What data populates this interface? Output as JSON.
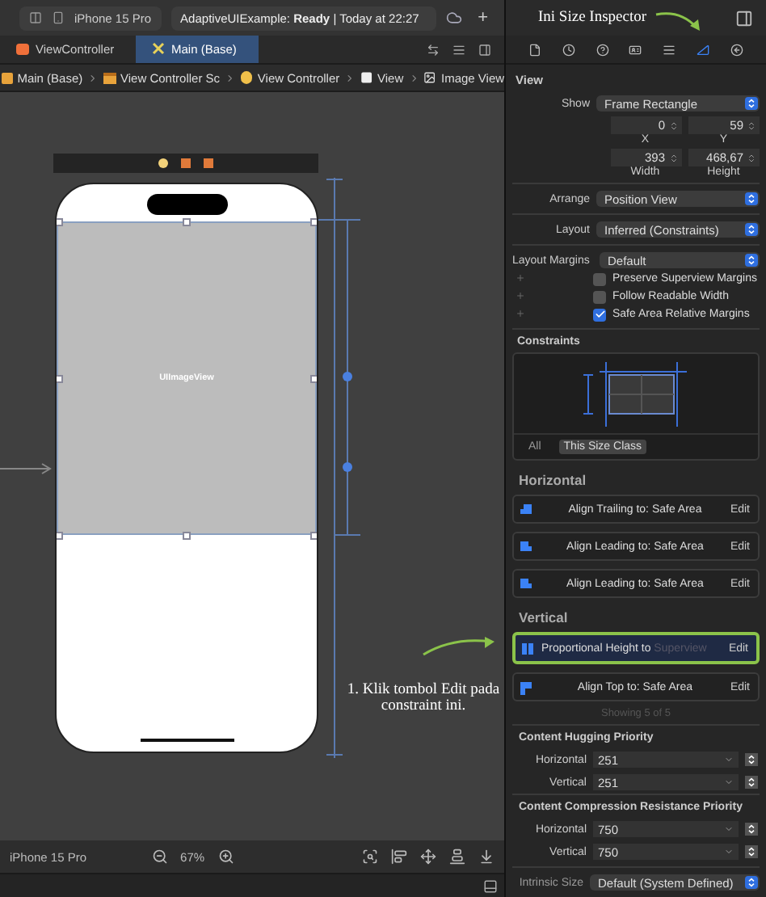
{
  "toolbar": {
    "device": "iPhone 15 Pro",
    "status": "AdaptiveUIExample: **Ready** | Today at 22:27",
    "add_button": "+"
  },
  "annotations": [
    {
      "text": "Ini Size Inspector"
    },
    {
      "text": "1. Klik tombol Edit pada constraint ini."
    }
  ],
  "editor_tabs": [
    {
      "label": "ViewController",
      "selected": false,
      "kind": "swift"
    },
    {
      "label": "Main (Base)",
      "selected": true,
      "kind": "storyboard"
    }
  ],
  "breadcrumb": [
    {
      "label": "Main (Base)",
      "kind": "storyboard"
    },
    {
      "label": "View Controller Sc",
      "kind": "scene"
    },
    {
      "label": "View Controller",
      "kind": "controller"
    },
    {
      "label": "View",
      "kind": "view"
    },
    {
      "label": "Image View",
      "kind": "image"
    }
  ],
  "inspector_tabs": [
    {
      "kind": "file",
      "selected": false
    },
    {
      "kind": "history",
      "selected": false
    },
    {
      "kind": "help",
      "selected": false
    },
    {
      "kind": "identity",
      "selected": false
    },
    {
      "kind": "attributes",
      "selected": false
    },
    {
      "kind": "size",
      "selected": true
    },
    {
      "kind": "connections",
      "selected": false
    }
  ],
  "canvas": {
    "image_view_label": "UIImageView"
  },
  "bottom_bar": {
    "device": "iPhone 15 Pro",
    "zoom": "67%"
  },
  "inspector": {
    "section": "View",
    "show": {
      "label": "Show",
      "value": "Frame Rectangle"
    },
    "frame_fields": [
      {
        "label": "X",
        "value": "0"
      },
      {
        "label": "Y",
        "value": "59"
      },
      {
        "label": "Width",
        "value": "393"
      },
      {
        "label": "Height",
        "value": "468,67"
      }
    ],
    "popups": [
      {
        "label": "Arrange",
        "value": "Position View"
      },
      {
        "label": "Layout",
        "value": "Inferred (Constraints)"
      },
      {
        "label": "Layout Margins",
        "value": "Default"
      }
    ],
    "checkboxes": [
      {
        "label": "Preserve Superview Margins",
        "checked": false
      },
      {
        "label": "Follow Readable Width",
        "checked": false
      },
      {
        "label": "Safe Area Relative Margins",
        "checked": true
      }
    ],
    "constraints": {
      "title": "Constraints",
      "filters": [
        {
          "label": "All",
          "selected": false
        },
        {
          "label": "This Size Class",
          "selected": true
        }
      ],
      "groups": [
        {
          "title": "Horizontal",
          "rows": [
            {
              "kind": "trailing",
              "text": "Align Trailing to:",
              "target": "Safe Area",
              "target_dimmed": false,
              "edit": "Edit",
              "highlighted": false
            },
            {
              "kind": "leading",
              "text": "Align Leading to:",
              "target": "Safe Area",
              "target_dimmed": false,
              "edit": "Edit",
              "highlighted": false
            },
            {
              "kind": "leading",
              "text": "Align Leading to:",
              "target": "Safe Area",
              "target_dimmed": false,
              "edit": "Edit",
              "highlighted": false
            }
          ]
        },
        {
          "title": "Vertical",
          "rows": [
            {
              "kind": "height",
              "text": "Proportional Height to",
              "target": "Superview",
              "target_dimmed": true,
              "edit": "Edit",
              "highlighted": true
            },
            {
              "kind": "top",
              "text": "Align Top to:",
              "target": "Safe Area",
              "target_dimmed": false,
              "edit": "Edit",
              "highlighted": false
            }
          ]
        }
      ],
      "footer": "Showing 5 of 5"
    },
    "priorities": [
      {
        "title": "Content Hugging Priority",
        "rows": [
          {
            "label": "Horizontal",
            "value": "251"
          },
          {
            "label": "Vertical",
            "value": "251"
          }
        ]
      },
      {
        "title": "Content Compression Resistance Priority",
        "rows": [
          {
            "label": "Horizontal",
            "value": "750"
          },
          {
            "label": "Vertical",
            "value": "750"
          }
        ]
      }
    ],
    "intrinsic_size": {
      "label": "Intrinsic Size",
      "value": "Default (System Defined)"
    }
  }
}
